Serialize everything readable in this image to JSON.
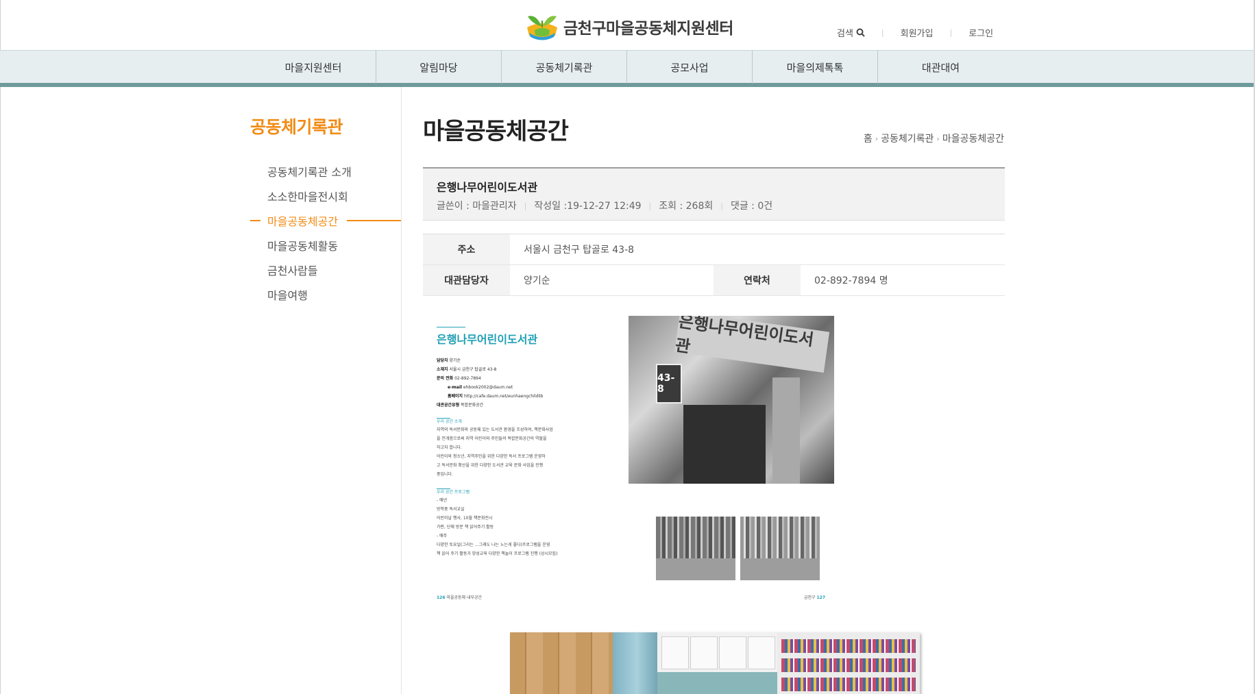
{
  "header": {
    "logo_text": "금천구마을공동체지원센터",
    "util": {
      "search": "검색",
      "join": "회원가입",
      "login": "로그인"
    }
  },
  "gnb": [
    "마을지원센터",
    "알림마당",
    "공동체기록관",
    "공모사업",
    "마을의제톡톡",
    "대관대여"
  ],
  "lnb": {
    "title": "공동체기록관",
    "items": [
      "공동체기록관 소개",
      "소소한마을전시회",
      "마을공동체공간",
      "마을공동체활동",
      "금천사람들",
      "마을여행"
    ],
    "active_index": 2
  },
  "content": {
    "page_title": "마을공동체공간",
    "breadcrumb": [
      "홈",
      "공동체기록관",
      "마을공동체공간"
    ],
    "post": {
      "title": "은행나무어린이도서관",
      "author": "글쓴이 : 마을관리자",
      "date": "작성일 :19-12-27 12:49",
      "views": "조회 : 268회",
      "comments": "댓글 : 0건"
    },
    "info": {
      "address_label": "주소",
      "address": "서울시 금천구 탑골로 43-8",
      "manager_label": "대관담당자",
      "manager": "양기순",
      "contact_label": "연락처",
      "contact": "02-892-7894 명"
    },
    "brochure": {
      "title": "은행나무어린이도서관",
      "lines": [
        [
          "담당자",
          "양기순"
        ],
        [
          "소재지",
          "서울시 금천구 탑골로 43-8"
        ],
        [
          "문의 전화",
          "02-892-7894"
        ],
        [
          "e-mail",
          "ehbook2002@daum.net"
        ],
        [
          "홈페이지",
          "http://cafe.daum.net/eunhaengchildlib"
        ],
        [
          "대관공간유형",
          "복합문화공간"
        ]
      ],
      "section1": "우리 공간 소개",
      "para1": [
        "지역의 독서문화와 공동체 있는 도서관 환경을 조성하여, 책문화사업",
        "을 전개함으로써 지역 어린이와 주민들의 복합문화공간의 역할을",
        "하고자 합니다.",
        "어린이와 청소년, 지역주민을 위한 다양한 독서 프로그램 운영하",
        "고 독서문화 확산을 위한 다양한 도서관 교육 문화 사업을 진행",
        "중입니다."
      ],
      "section2": "우리 공간 프로그램",
      "para2": [
        "- 매년",
        "  방학중 독서교실",
        "  어린이날 행사, 10월 책문화전시",
        "  가판, 단체 방문 책 읽어주기 활동",
        "- 매주",
        "  다양한 토요일(그리는 ...그래도 나는 노는게 좋다)프로그램을 운영",
        "  책 읽어 주기 활동가 양성교육 다양한 책놀이 프로그램 진행 (상시모집)"
      ],
      "page_left_num": "126",
      "page_left_text": "마을공동체 내부공간",
      "page_right_text": "금천구",
      "page_right_num": "127",
      "sign_text": "은행나무어린이도서관",
      "house_number": "43-8"
    }
  }
}
